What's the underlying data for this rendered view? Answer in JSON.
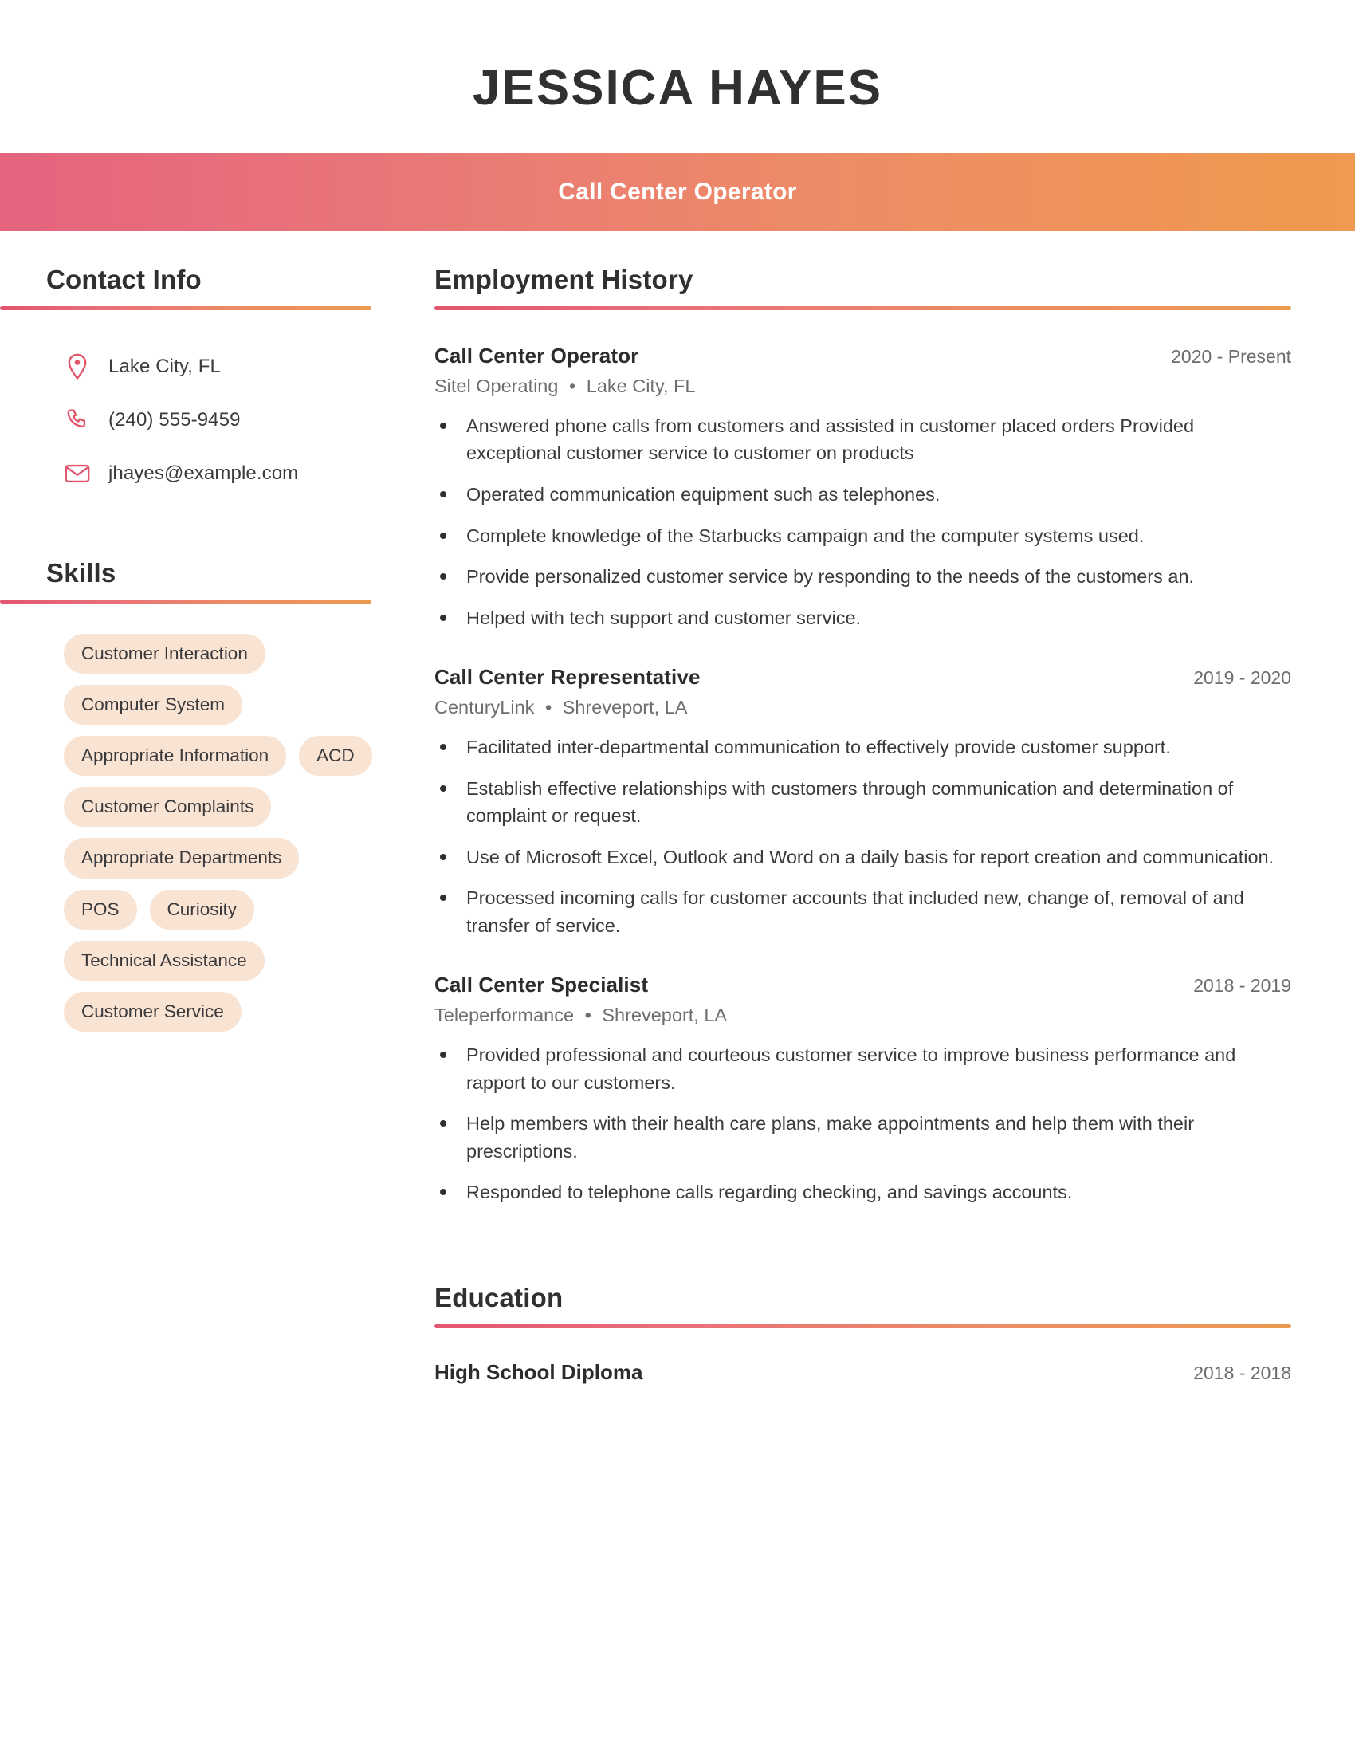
{
  "header": {
    "name": "JESSICA HAYES",
    "job_title": "Call Center Operator",
    "gradient_start": "#e4647e",
    "gradient_end": "#ef9a4e"
  },
  "sidebar": {
    "contact": {
      "heading": "Contact Info",
      "items": [
        {
          "icon": "location-pin-icon",
          "text": "Lake City, FL"
        },
        {
          "icon": "phone-icon",
          "text": "(240) 555-9459"
        },
        {
          "icon": "envelope-icon",
          "text": "jhayes@example.com"
        }
      ]
    },
    "skills": {
      "heading": "Skills",
      "items": [
        "Customer Interaction",
        "Computer System",
        "Appropriate Information",
        "ACD",
        "Customer Complaints",
        "Appropriate Departments",
        "POS",
        "Curiosity",
        "Technical Assistance",
        "Customer Service"
      ],
      "pill_color": "#f9e3d3"
    }
  },
  "main": {
    "employment": {
      "heading": "Employment History",
      "jobs": [
        {
          "title": "Call Center Operator",
          "company": "Sitel Operating",
          "location": "Lake City, FL",
          "dates": "2020 - Present",
          "bullets": [
            "Answered phone calls from customers and assisted in customer placed orders Provided exceptional customer service to customer on products",
            "Operated communication equipment such as telephones.",
            "Complete knowledge of the Starbucks campaign and the computer systems used.",
            "Provide personalized customer service by responding to the needs of the customers an.",
            "Helped with tech support and customer service."
          ]
        },
        {
          "title": "Call Center Representative",
          "company": "CenturyLink",
          "location": "Shreveport, LA",
          "dates": "2019 - 2020",
          "bullets": [
            "Facilitated inter-departmental communication to effectively provide customer support.",
            "Establish effective relationships with customers through communication and determination of complaint or request.",
            "Use of Microsoft Excel, Outlook and Word on a daily basis for report creation and communication.",
            "Processed incoming calls for customer accounts that included new, change of, removal of and transfer of service."
          ]
        },
        {
          "title": "Call Center Specialist",
          "company": "Teleperformance",
          "location": "Shreveport, LA",
          "dates": "2018 - 2019",
          "bullets": [
            "Provided professional and courteous customer service to improve business performance and rapport to our customers.",
            "Help members with their health care plans, make appointments and help them with their prescriptions.",
            "Responded to telephone calls regarding checking, and savings accounts."
          ]
        }
      ]
    },
    "education": {
      "heading": "Education",
      "entries": [
        {
          "degree": "High School Diploma",
          "dates": "2018 - 2018"
        }
      ]
    }
  },
  "separator_bullet": "•"
}
